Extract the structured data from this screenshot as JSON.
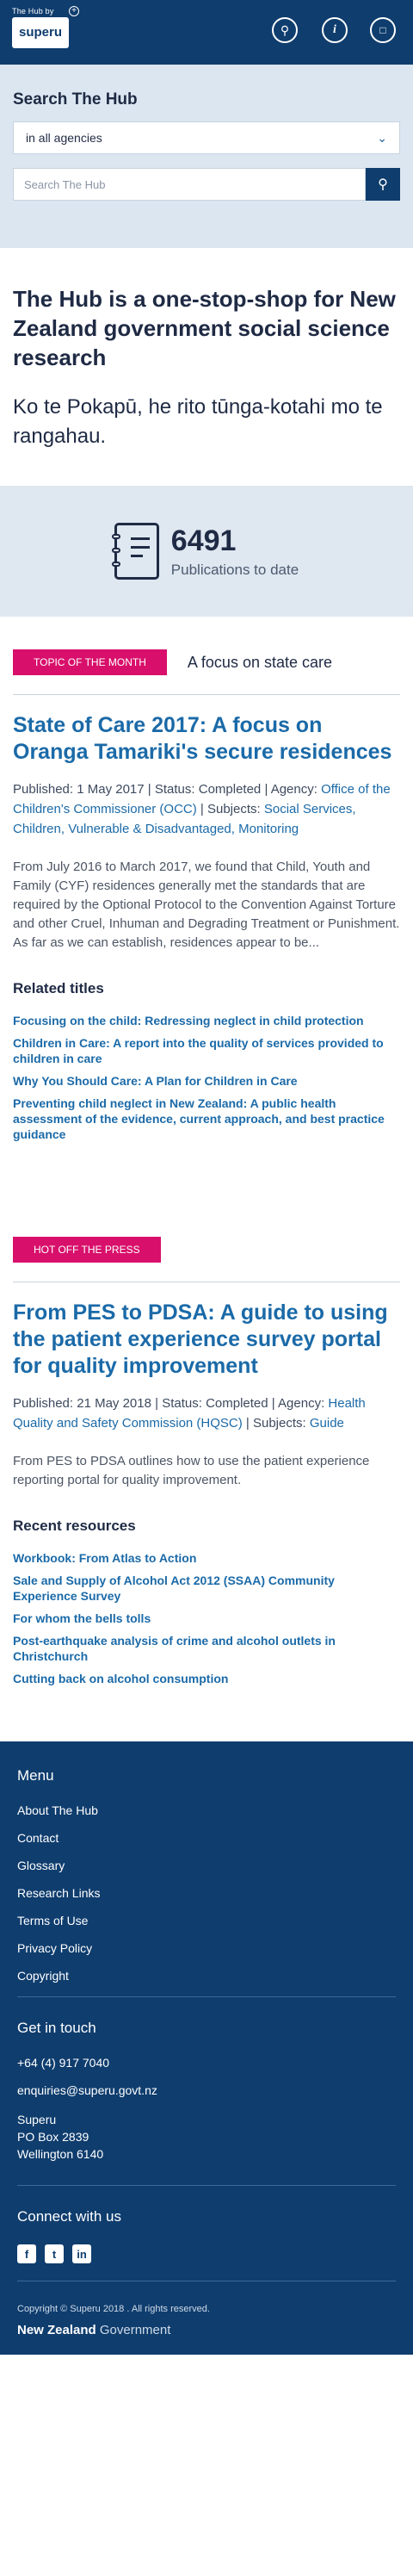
{
  "header": {
    "small_logo_text": "The Hub by",
    "logo_text": "superu",
    "plus_symbol": "+"
  },
  "search": {
    "title": "Search The Hub",
    "agency_select": "in all agencies",
    "placeholder": "Search The Hub"
  },
  "intro": {
    "heading": "The Hub is a one-stop-shop for New Zealand government social science research",
    "maori": "Ko te Pokapū, he rito tūnga-kotahi mo te rangahau."
  },
  "stats": {
    "count": "6491",
    "label": "Publications to date"
  },
  "topic": {
    "tag": "TOPIC OF THE MONTH",
    "label": "A focus on state care",
    "title": "State of Care 2017: A focus on Oranga Tamariki's secure residences",
    "published_label": "Published:",
    "published": "1 May 2017",
    "status_label": "Status:",
    "status": "Completed",
    "agency_label": "Agency:",
    "agency": "Office of the Children's Commissioner (OCC)",
    "subjects_label": "Subjects:",
    "subjects": "Social Services, Children, Vulnerable & Disadvantaged, Monitoring",
    "summary": "From July 2016 to March 2017, we found that Child, Youth and Family (CYF) residences generally met the standards that are required by the Optional Protocol to the Convention Against Torture and other Cruel, Inhuman and Degrading Treatment or Punishment. As far as we can establish, residences appear to be...",
    "related_heading": "Related titles",
    "related": [
      "Focusing on the child: Redressing neglect in child protection",
      "Children in Care: A report into the quality of services provided to children in care",
      "Why You Should Care: A Plan for Children in Care",
      "Preventing child neglect in New Zealand: A public health assessment of the evidence, current approach, and best practice guidance"
    ]
  },
  "press": {
    "tag": "HOT OFF THE PRESS",
    "title": "From PES to PDSA: A guide to using the patient experience survey portal for quality improvement",
    "published_label": "Published:",
    "published": "21 May 2018",
    "status_label": "Status:",
    "status": "Completed",
    "agency_label": "Agency:",
    "agency": "Health Quality and Safety Commission (HQSC)",
    "subjects_label": "Subjects:",
    "subjects": "Guide",
    "summary": "From PES to PDSA outlines how to use the patient experience reporting portal for quality improvement.",
    "recent_heading": "Recent resources",
    "recent": [
      "Workbook: From Atlas to Action",
      "Sale and Supply of Alcohol Act 2012 (SSAA) Community Experience Survey",
      "For whom the bells tolls",
      "Post-earthquake analysis of crime and alcohol outlets in Christchurch",
      "Cutting back on alcohol consumption"
    ]
  },
  "footer": {
    "menu_heading": "Menu",
    "menu": [
      "About The Hub",
      "Contact",
      "Glossary",
      "Research Links",
      "Terms of Use",
      "Privacy Policy",
      "Copyright"
    ],
    "contact_heading": "Get in touch",
    "phone": "+64 (4) 917 7040",
    "email": "enquiries@superu.govt.nz",
    "address_1": "Superu",
    "address_2": "PO Box 2839",
    "address_3": "Wellington 6140",
    "social_heading": "Connect with us",
    "social": [
      "facebook-icon",
      "twitter-icon",
      "linkedin-icon"
    ],
    "copyright": "Copyright © Superu 2018 . All rights reserved.",
    "govt_prefix": "New Zealand",
    "govt_suffix": " Government"
  },
  "colors": {
    "navy": "#0f3d6e",
    "link": "#1b6aa8",
    "tag": "#d8106b",
    "search_bg": "#dbe6f1"
  }
}
